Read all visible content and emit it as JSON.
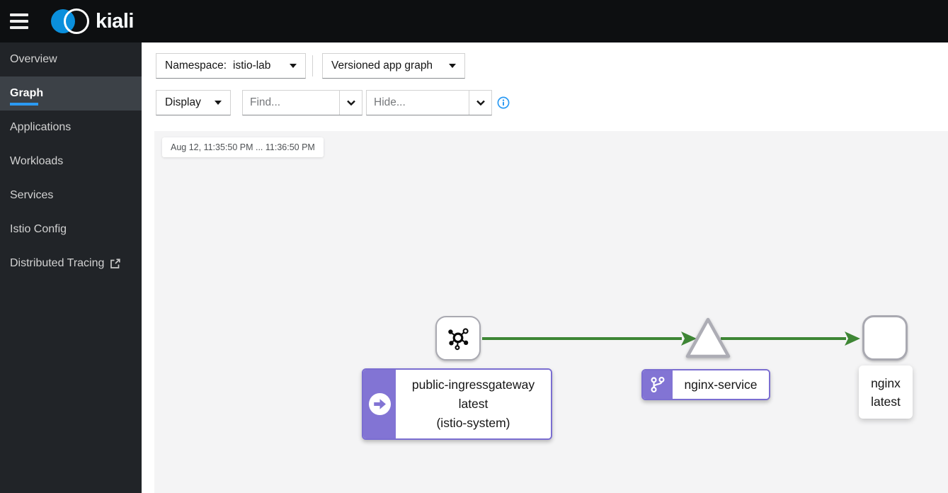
{
  "masthead": {
    "brand": "kiali"
  },
  "sidebar": {
    "items": [
      {
        "label": "Overview"
      },
      {
        "label": "Graph"
      },
      {
        "label": "Applications"
      },
      {
        "label": "Workloads"
      },
      {
        "label": "Services"
      },
      {
        "label": "Istio Config"
      },
      {
        "label": "Distributed Tracing"
      }
    ]
  },
  "toolbar": {
    "namespace_label": "Namespace:",
    "namespace_value": "istio-lab",
    "graph_type": "Versioned app graph",
    "display_label": "Display",
    "find_placeholder": "Find...",
    "hide_placeholder": "Hide..."
  },
  "graph": {
    "time_range_label": "Aug 12, 11:35:50 PM ... 11:36:50 PM",
    "gateway_app": {
      "line1": "public-ingressgateway",
      "line2": "latest",
      "line3": "(istio-system)"
    },
    "service": {
      "label": "nginx-service"
    },
    "app": {
      "line1": "nginx",
      "line2": "latest"
    }
  },
  "colors": {
    "accent_blue": "#2b9af3",
    "brand_blue": "#0a8fdc",
    "node_purple": "#8274d4",
    "node_purple_border": "#7b6ed1",
    "edge_green": "#3e8635",
    "masthead_black": "#0d0f11",
    "sidebar_dark": "#212428",
    "graph_bg": "#f4f4f5"
  }
}
